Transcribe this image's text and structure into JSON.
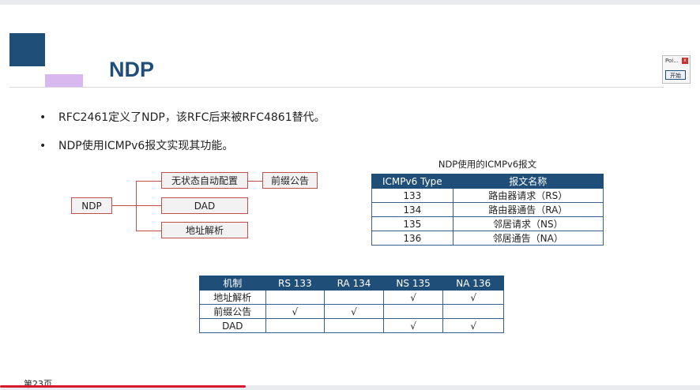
{
  "slide": {
    "title": "NDP",
    "bullets": [
      "RFC2461定义了NDP，该RFC后来被RFC4861替代。",
      "NDP使用ICMPv6报文实现其功能。"
    ],
    "bullet_marker": "•",
    "tree": {
      "root": "NDP",
      "branches": [
        "无状态自动配置",
        "DAD",
        "地址解析"
      ],
      "leaf": "前缀公告"
    },
    "icmp_table": {
      "caption": "NDP使用的ICMPv6报文",
      "headers": [
        "ICMPv6 Type",
        "报文名称"
      ],
      "rows": [
        [
          "133",
          "路由器请求（RS）"
        ],
        [
          "134",
          "路由器通告（RA）"
        ],
        [
          "135",
          "邻居请求（NS）"
        ],
        [
          "136",
          "邻居通告（NA）"
        ]
      ]
    },
    "mechanism_table": {
      "headers": [
        "机制",
        "RS 133",
        "RA 134",
        "NS 135",
        "NA 136"
      ],
      "rows": [
        [
          "地址解析",
          "",
          "",
          "√",
          "√"
        ],
        [
          "前缀公告",
          "√",
          "√",
          "",
          ""
        ],
        [
          "DAD",
          "",
          "",
          "√",
          "√"
        ]
      ]
    },
    "page_label": "第23页"
  },
  "widget": {
    "title": "Poi...",
    "close": "x",
    "start": "开始"
  },
  "colors": {
    "accent": "#1f4e79",
    "purple": "#d9b8ef",
    "tree_border": "#c0504d",
    "progress": "#d6192f"
  }
}
